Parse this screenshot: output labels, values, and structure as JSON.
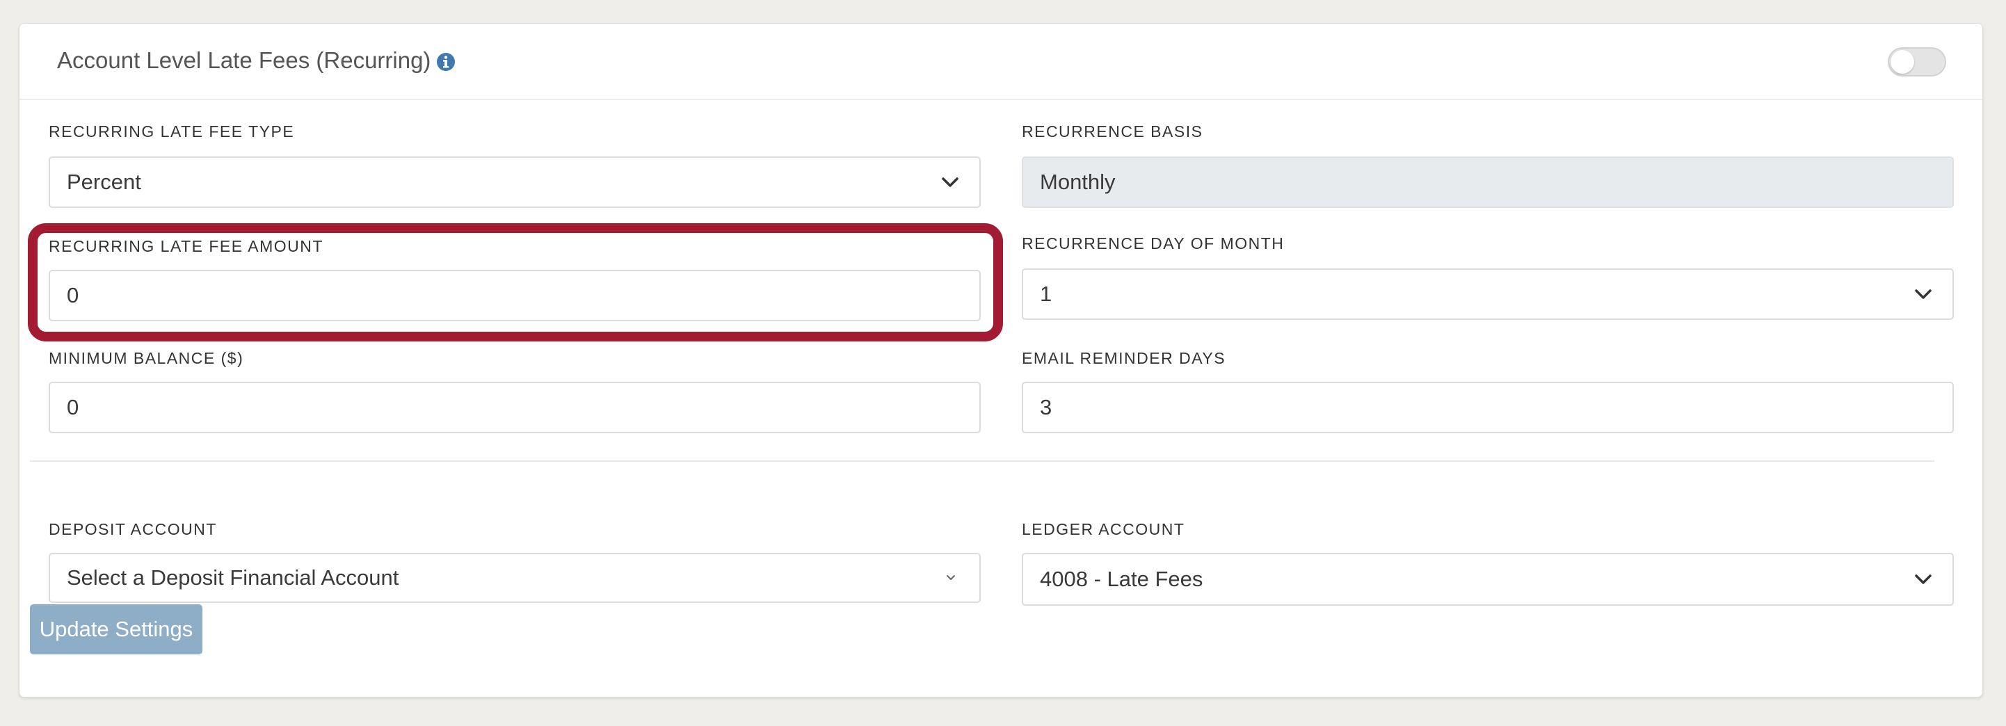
{
  "panel": {
    "title": "Account Level Late Fees (Recurring)",
    "info_icon": "info-circle-icon",
    "toggle_on": false
  },
  "fields": {
    "late_fee_type": {
      "label": "RECURRING LATE FEE TYPE",
      "value": "Percent"
    },
    "recurrence_basis": {
      "label": "RECURRENCE BASIS",
      "value": "Monthly"
    },
    "late_fee_amount": {
      "label": "RECURRING LATE FEE AMOUNT",
      "value": "0"
    },
    "recurrence_day": {
      "label": "RECURRENCE DAY OF MONTH",
      "value": "1"
    },
    "minimum_balance": {
      "label": "MINIMUM BALANCE ($)",
      "value": "0"
    },
    "email_reminder_days": {
      "label": "EMAIL REMINDER DAYS",
      "value": "3"
    },
    "deposit_account": {
      "label": "DEPOSIT ACCOUNT",
      "value": "Select a Deposit Financial Account"
    },
    "ledger_account": {
      "label": "LEDGER ACCOUNT",
      "value": "4008 - Late Fees"
    }
  },
  "actions": {
    "update_label": "Update Settings"
  },
  "colors": {
    "highlight": "#a31a33",
    "info_icon": "#3f79b0",
    "button": "#8eaec8"
  }
}
